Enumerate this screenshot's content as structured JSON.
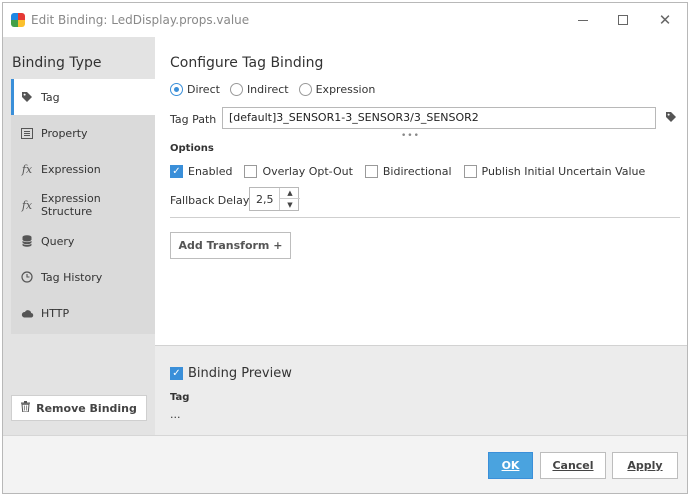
{
  "window": {
    "title": "Edit Binding: LedDisplay.props.value"
  },
  "sidebar": {
    "heading": "Binding Type",
    "items": [
      {
        "label": "Tag",
        "icon": "tag-icon",
        "active": true
      },
      {
        "label": "Property",
        "icon": "list-icon"
      },
      {
        "label": "Expression",
        "icon": "fx-icon"
      },
      {
        "label": "Expression Structure",
        "icon": "fx-icon"
      },
      {
        "label": "Query",
        "icon": "database-icon"
      },
      {
        "label": "Tag History",
        "icon": "clock-icon"
      },
      {
        "label": "HTTP",
        "icon": "cloud-icon"
      }
    ],
    "remove_label": "Remove Binding"
  },
  "config": {
    "title": "Configure Tag Binding",
    "modes": [
      {
        "label": "Direct",
        "selected": true
      },
      {
        "label": "Indirect",
        "selected": false
      },
      {
        "label": "Expression",
        "selected": false
      }
    ],
    "tag_path_label": "Tag Path",
    "tag_path_value": "[default]3_SENSOR1-3_SENSOR3/3_SENSOR2",
    "options_label": "Options",
    "options": [
      {
        "label": "Enabled",
        "checked": true
      },
      {
        "label": "Overlay Opt-Out",
        "checked": false
      },
      {
        "label": "Bidirectional",
        "checked": false
      },
      {
        "label": "Publish Initial Uncertain Value",
        "checked": false
      }
    ],
    "fallback_label": "Fallback Delay",
    "fallback_value": "2,5",
    "add_transform_label": "Add Transform +"
  },
  "preview": {
    "label": "Binding Preview",
    "checked": true,
    "tag_label": "Tag",
    "value": "..."
  },
  "footer": {
    "ok_label": "OK",
    "cancel_label": "Cancel",
    "apply_label": "Apply"
  },
  "colors": {
    "accent": "#3a8fd9",
    "ok_button": "#4aa3df"
  }
}
